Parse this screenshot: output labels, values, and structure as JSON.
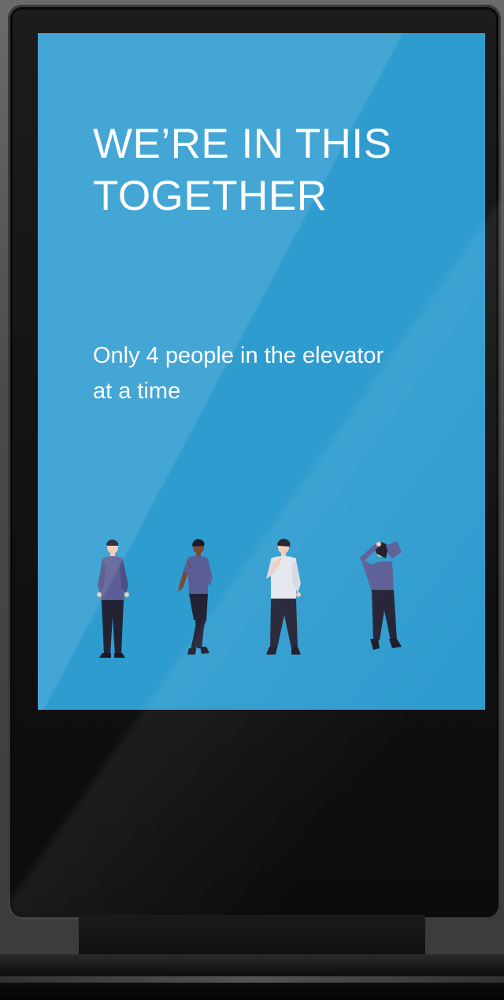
{
  "sign": {
    "headline": "WE’RE IN THIS TOGETHER",
    "subtext": "Only 4 people in the elevator at a time"
  },
  "colors": {
    "screen_background": "#2f9ccf",
    "text": "#ffffff",
    "figure_shirt_dark": "#5a5e94",
    "figure_shirt_light": "#e4e6ee",
    "figure_pants": "#232235",
    "figure_skin_light": "#f3c9b5",
    "figure_skin_dark": "#7a4a36",
    "figure_hair": "#1d1b28"
  },
  "figures": [
    {
      "name": "person-standing-hands-at-sides"
    },
    {
      "name": "person-leaning-hand-in-pocket"
    },
    {
      "name": "person-hand-on-chin"
    },
    {
      "name": "person-hand-on-head"
    }
  ]
}
